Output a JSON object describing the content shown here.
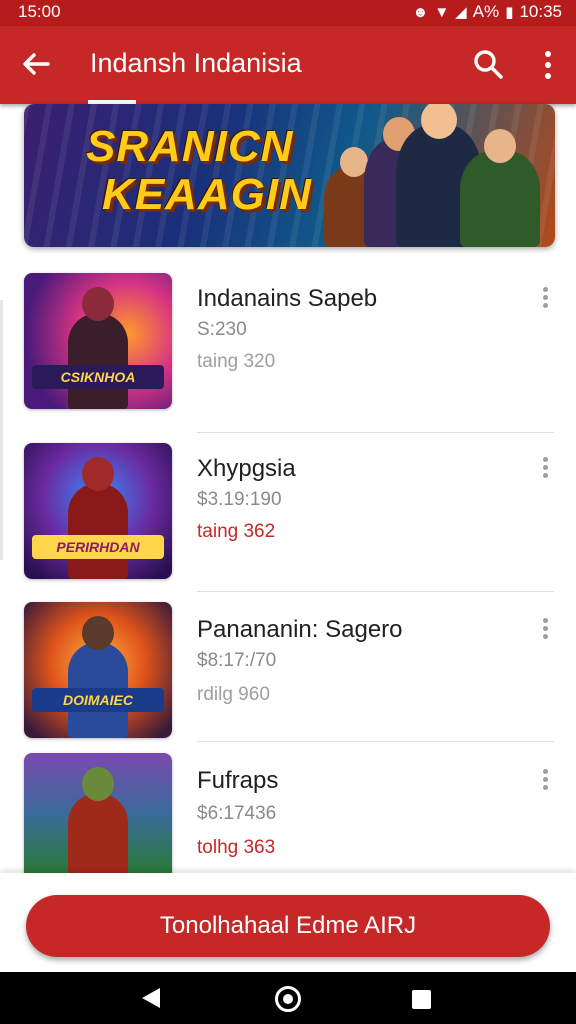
{
  "status_bar": {
    "time": "15:00",
    "battery_text": "A%",
    "right_time": "10:35",
    "icons": [
      "notification-icon",
      "wifi-icon",
      "signal-icon",
      "battery-icon"
    ]
  },
  "app_bar": {
    "title": "Indansh Indanisia",
    "back_icon": "arrow-left-icon",
    "search_icon": "search-icon",
    "more_icon": "more-vertical-icon"
  },
  "banner": {
    "line1": "SRANICN",
    "line2": "KEAAGIN"
  },
  "items": [
    {
      "name": "Indanains Sapeb",
      "price": "S:230",
      "rating": "taing 320",
      "rating_color": "#9e9e9e",
      "thumb_logo": "CSIKNHOA"
    },
    {
      "name": "Xhypgsia",
      "price": "$3.19:190",
      "rating": "taing 362",
      "rating_color": "#c62828",
      "thumb_logo": "PERIRHDAN"
    },
    {
      "name": "Panananin: Sagero",
      "price": "$8:17:/70",
      "rating": "rdilg 960",
      "rating_color": "#9e9e9e",
      "thumb_logo": "DOIMAIEC"
    },
    {
      "name": "Fufraps",
      "price": "$6:17436",
      "rating": "tolhg 363",
      "rating_color": "#c62828",
      "thumb_logo": ""
    }
  ],
  "cta": {
    "label": "Tonolhahaal Edme AIRJ"
  },
  "colors": {
    "primary": "#c62828",
    "status_bar": "#b71c1c",
    "accent_rating": "#c62828"
  }
}
